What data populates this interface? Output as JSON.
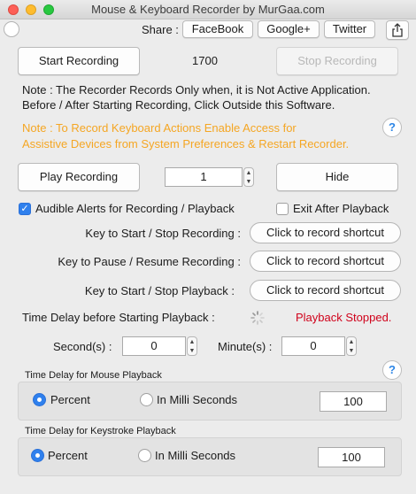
{
  "window": {
    "title": "Mouse & Keyboard Recorder by MurGaa.com"
  },
  "share": {
    "label": "Share :",
    "facebook": "FaceBook",
    "google": "Google+",
    "twitter": "Twitter"
  },
  "recording": {
    "start_label": "Start Recording",
    "count": "1700",
    "stop_label": "Stop Recording"
  },
  "notes": {
    "line1": "Note : The Recorder Records Only when, it is Not Active Application.",
    "line2": "Before / After Starting Recording, Click Outside this Software.",
    "orange1": "Note : To Record Keyboard Actions Enable Access for",
    "orange2": "Assistive Devices from System Preferences & Restart Recorder."
  },
  "playback": {
    "play_label": "Play Recording",
    "repeat": "1",
    "hide_label": "Hide"
  },
  "options": {
    "audible_label": "Audible Alerts for Recording / Playback",
    "audible_checked": true,
    "exit_label": "Exit After Playback",
    "exit_checked": false
  },
  "shortcuts": [
    {
      "label": "Key to Start / Stop Recording :",
      "button": "Click to record shortcut"
    },
    {
      "label": "Key to Pause / Resume Recording :",
      "button": "Click to record shortcut"
    },
    {
      "label": "Key to Start / Stop Playback  :",
      "button": "Click to record shortcut"
    }
  ],
  "delay": {
    "label": "Time Delay before Starting Playback :",
    "status": "Playback Stopped.",
    "seconds_label": "Second(s) :",
    "seconds": "0",
    "minutes_label": "Minute(s) :",
    "minutes": "0"
  },
  "mouse_delay": {
    "title": "Time Delay for Mouse Playback",
    "percent_label": "Percent",
    "milli_label": "In Milli Seconds",
    "selected": "percent",
    "value": "100"
  },
  "key_delay": {
    "title": "Time Delay for Keystroke Playback",
    "percent_label": "Percent",
    "milli_label": "In Milli Seconds",
    "selected": "percent",
    "value": "100"
  },
  "help_glyph": "?",
  "colors": {
    "accent": "#2f80ed",
    "note_orange": "#f5a623",
    "status_red": "#d0021b"
  }
}
